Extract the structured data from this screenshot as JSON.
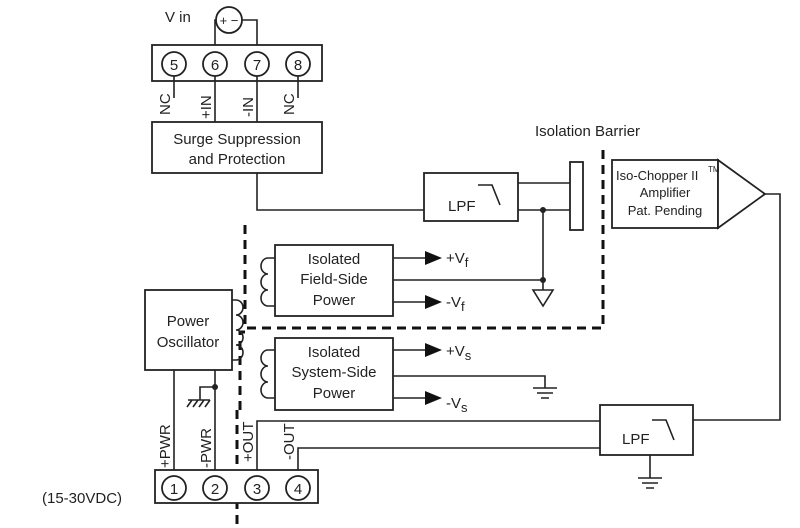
{
  "vin_label": "V in",
  "source_symbol": "+ −",
  "input_terminals": [
    {
      "number": "5",
      "label": "NC"
    },
    {
      "number": "6",
      "label": "+IN"
    },
    {
      "number": "7",
      "label": "-IN"
    },
    {
      "number": "8",
      "label": "NC"
    }
  ],
  "surge_box": {
    "line1": "Surge Suppression",
    "line2": "and Protection"
  },
  "lpf_label": "LPF",
  "isolation_barrier_label": "Isolation Barrier",
  "amplifier": {
    "line1": "Iso-Chopper II",
    "tm": "TM",
    "line2": "Amplifier",
    "line3": "Pat. Pending"
  },
  "field_power": {
    "line1": "Isolated",
    "line2": "Field-Side",
    "line3": "Power",
    "pos": "+V",
    "neg": "-V",
    "sub": "f"
  },
  "system_power": {
    "line1": "Isolated",
    "line2": "System-Side",
    "line3": "Power",
    "pos": "+V",
    "neg": "-V",
    "sub": "s"
  },
  "oscillator": {
    "line1": "Power",
    "line2": "Oscillator"
  },
  "output_terminals": [
    {
      "number": "1",
      "label": "+PWR"
    },
    {
      "number": "2",
      "label": "-PWR"
    },
    {
      "number": "3",
      "label": "+OUT"
    },
    {
      "number": "4",
      "label": "-OUT"
    }
  ],
  "supply_range": "(15-30VDC)"
}
